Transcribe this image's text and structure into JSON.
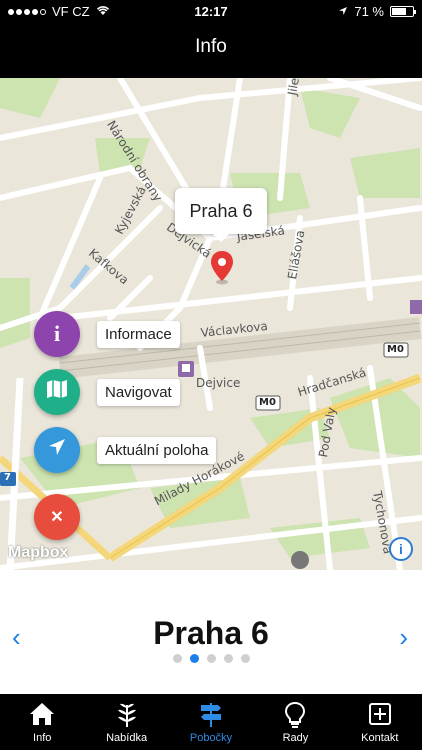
{
  "status_bar": {
    "carrier": "VF CZ",
    "time": "12:17",
    "battery": "71 %",
    "battery_level": 0.71
  },
  "nav": {
    "title": "Info"
  },
  "map": {
    "callout": "Praha 6",
    "streets": [
      "Národní obrany",
      "Jilemnického",
      "Kyjevská",
      "Dejvická",
      "Jaselská",
      "Eliášova",
      "Kafkova",
      "Václavkova",
      "Dejvice",
      "Hradčanská",
      "Pod Valy",
      "Milady Horákové",
      "Tychonova",
      "M0",
      "M0",
      "7"
    ],
    "actions": [
      {
        "label": "Informace",
        "icon": "info-icon",
        "color": "#8e44ad"
      },
      {
        "label": "Navigovat",
        "icon": "map-icon",
        "color": "#1fb08a"
      },
      {
        "label": "Aktuální poloha",
        "icon": "location-arrow-icon",
        "color": "#3498db"
      }
    ],
    "close_color": "#e74c3c",
    "attribution": "Mapbox"
  },
  "pager": {
    "title": "Praha 6",
    "prev": "‹",
    "next": "›",
    "pages": 5,
    "active_page": 2
  },
  "tabs": [
    {
      "label": "Info",
      "icon": "home-icon",
      "active": false
    },
    {
      "label": "Nabídka",
      "icon": "leaf-icon",
      "active": false
    },
    {
      "label": "Pobočky",
      "icon": "signpost-icon",
      "active": true
    },
    {
      "label": "Rady",
      "icon": "lightbulb-icon",
      "active": false
    },
    {
      "label": "Kontakt",
      "icon": "plus-box-icon",
      "active": false
    }
  ]
}
